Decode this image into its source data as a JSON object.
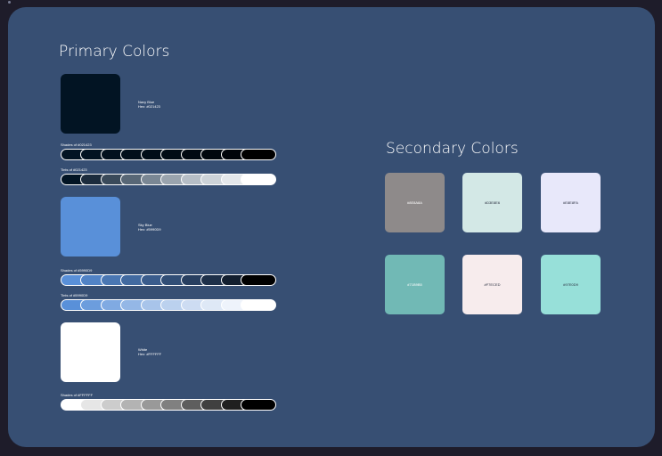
{
  "primary": {
    "title": "Primary Colors",
    "colors": [
      {
        "name": "Navy Blue",
        "hex_label": "Hex: #021423",
        "hex": "#021423",
        "shades_label": "Shades of #021423",
        "shades": [
          "#021423",
          "#021321",
          "#02111e",
          "#020f1b",
          "#010d18",
          "#010b15",
          "#010912",
          "#01070e",
          "#00040a",
          "#000000"
        ],
        "tints_label": "Tints of #021423",
        "tints": [
          "#021423",
          "#1c2c3d",
          "#3a4a5a",
          "#586776",
          "#7a8794",
          "#9aa4ae",
          "#b6bec6",
          "#cdd3d8",
          "#e4e7ea",
          "#ffffff"
        ]
      },
      {
        "name": "Sky Blue",
        "hex_label": "Hex: #5990D9",
        "hex": "#5990D9",
        "shades_label": "Shades of #5990D9",
        "shades": [
          "#5990d9",
          "#5183c6",
          "#4a77b3",
          "#426aa0",
          "#3a5c8c",
          "#314e76",
          "#283f60",
          "#1e3049",
          "#131f2f",
          "#000000"
        ],
        "tints_label": "Tints of #5990D9",
        "tints": [
          "#5990d9",
          "#6c9ddd",
          "#80aae2",
          "#94b7e6",
          "#a8c4ea",
          "#bbd1ee",
          "#cddcf2",
          "#dee8f6",
          "#eef3fb",
          "#ffffff"
        ]
      },
      {
        "name": "White",
        "hex_label": "Hex: #FFFFFF",
        "hex": "#FFFFFF",
        "shades_label": "Shades of #FFFFFF",
        "shades": [
          "#ffffff",
          "#e6e6e6",
          "#cccccc",
          "#b3b3b3",
          "#999999",
          "#808080",
          "#5e5e5e",
          "#404040",
          "#202020",
          "#000000"
        ]
      }
    ]
  },
  "secondary": {
    "title": "Secondary Colors",
    "swatches": [
      {
        "label": "#8E8A8A",
        "color": "#8e8a8a",
        "text_color": "#ffffff"
      },
      {
        "label": "#D3E8E6",
        "color": "#d3e8e6",
        "text_color": "#2b3040"
      },
      {
        "label": "#E8E8FA",
        "color": "#e8e8fa",
        "text_color": "#2b3040"
      },
      {
        "label": "#71B9B5",
        "color": "#71b9b5",
        "text_color": "#ffffff"
      },
      {
        "label": "#F7ECED",
        "color": "#f7eced",
        "text_color": "#2b3040"
      },
      {
        "label": "#97E0D9",
        "color": "#97e0d9",
        "text_color": "#2b3040"
      }
    ]
  }
}
